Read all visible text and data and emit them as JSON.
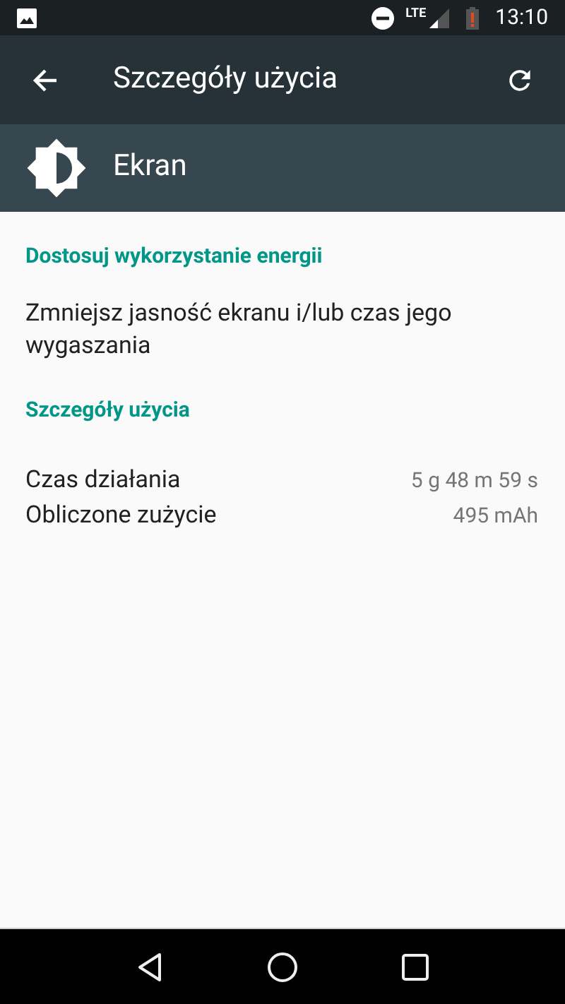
{
  "status_bar": {
    "network": "LTE",
    "time": "13:10"
  },
  "app_bar": {
    "title": "Szczegóły użycia"
  },
  "header": {
    "title": "Ekran"
  },
  "sections": [
    {
      "kind": "tip",
      "title": "Dostosuj wykorzystanie energii",
      "text": "Zmniejsz jasność ekranu i/lub czas jego wygaszania"
    },
    {
      "kind": "details",
      "title": "Szczegóły użycia",
      "rows": [
        {
          "label": "Czas działania",
          "value": "5 g 48 m 59 s"
        },
        {
          "label": "Obliczone zużycie",
          "value": "495 mAh"
        }
      ]
    }
  ]
}
